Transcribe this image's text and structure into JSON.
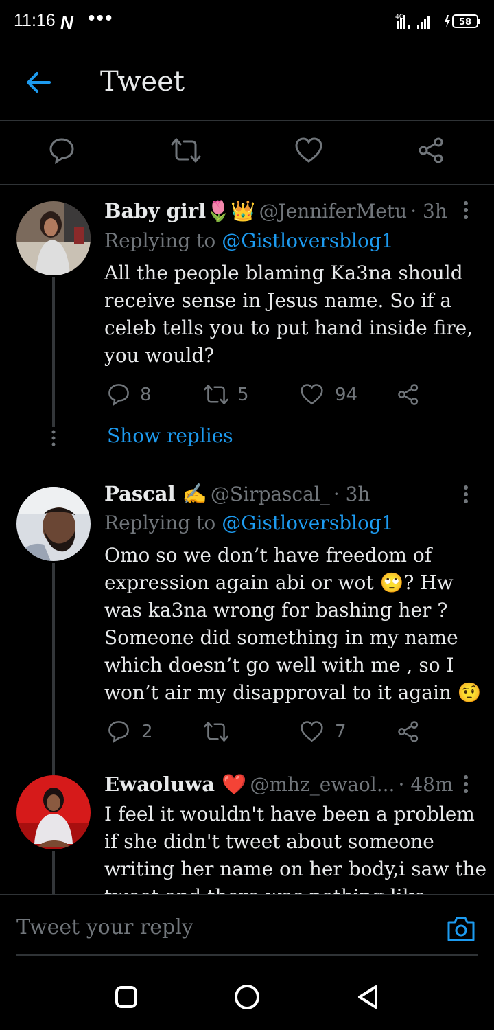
{
  "status_bar": {
    "time": "11:16",
    "app_icon": "N",
    "more": "•••",
    "network": "4G",
    "battery": "58"
  },
  "header": {
    "title": "Tweet"
  },
  "action_bar": {
    "icons": [
      "reply-icon",
      "retweet-icon",
      "like-icon",
      "share-icon"
    ]
  },
  "tweets": [
    {
      "name": "Baby girl🌷👑",
      "handle": "@JenniferMetu",
      "time": "· 3h",
      "replying_label": "Replying to",
      "replying_to": "@Gistloversblog1",
      "lines": [
        "All the people blaming Ka3na should",
        "receive sense in Jesus name. So if a",
        "celeb tells you to put hand inside fire,",
        "you would?"
      ],
      "replies": "8",
      "retweets": "5",
      "likes": "94",
      "show_replies": "Show replies"
    },
    {
      "name": "Pascal ✍",
      "handle": "@Sirpascal_",
      "time": "· 3h",
      "replying_label": "Replying to",
      "replying_to": "@Gistloversblog1",
      "lines": [
        "Omo so we don’t have freedom of",
        "expression again abi or wot 🙄? Hw",
        "was ka3na wrong for bashing her ?",
        "Someone did something in my name",
        "which doesn’t go well with me , so I",
        "won’t air my disapproval to it again 🤨"
      ],
      "replies": "2",
      "retweets": "",
      "likes": "7"
    },
    {
      "name": "Ewaoluwa ❤️",
      "handle": "@mhz_ewaol...",
      "time": "· 48m",
      "lines": [
        "I feel it wouldn't have been a problem",
        "if she didn't tweet about someone",
        "writing her name on her body,i saw the",
        "tweet and there was nothing like"
      ]
    }
  ],
  "reply_bar": {
    "placeholder": "Tweet your reply"
  },
  "colors": {
    "background": "#000000",
    "accent": "#1d9bf0",
    "muted": "#71767b",
    "text": "#e7e9ea",
    "divider": "#2f3336"
  }
}
